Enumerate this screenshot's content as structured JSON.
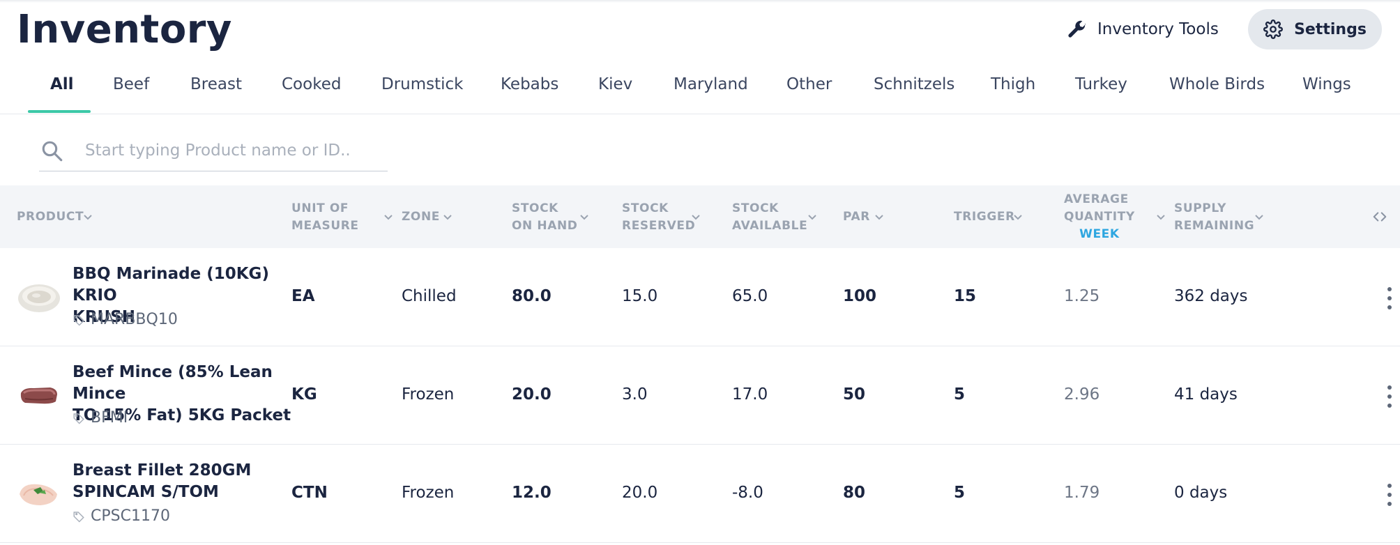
{
  "header": {
    "title": "Inventory",
    "tools_label": "Inventory Tools",
    "settings_label": "Settings"
  },
  "tabs": [
    {
      "label": "All",
      "active": true
    },
    {
      "label": "Beef"
    },
    {
      "label": "Breast"
    },
    {
      "label": "Cooked"
    },
    {
      "label": "Drumstick"
    },
    {
      "label": "Kebabs"
    },
    {
      "label": "Kiev"
    },
    {
      "label": "Maryland"
    },
    {
      "label": "Other"
    },
    {
      "label": "Schnitzels"
    },
    {
      "label": "Thigh"
    },
    {
      "label": "Turkey"
    },
    {
      "label": "Whole Birds"
    },
    {
      "label": "Wings"
    }
  ],
  "search": {
    "placeholder": "Start typing Product name or ID..",
    "value": ""
  },
  "table": {
    "columns": {
      "product": "PRODUCT",
      "uom_1": "UNIT OF",
      "uom_2": "MEASURE",
      "zone": "ZONE",
      "on_hand_1": "STOCK",
      "on_hand_2": "ON HAND",
      "reserved_1": "STOCK",
      "reserved_2": "RESERVED",
      "available_1": "STOCK",
      "available_2": "AVAILABLE",
      "par": "PAR",
      "trigger": "TRIGGER",
      "avg_1": "AVERAGE",
      "avg_2": "QUANTITY",
      "avg_period": "WEEK",
      "supply_1": "SUPPLY",
      "supply_2": "REMAINING"
    },
    "rows": [
      {
        "name_line1": "BBQ Marinade (10KG) KRIO",
        "name_line2": "KRUSH",
        "id": "MARBBQ10",
        "thumb": "marinade-bowl-thumb",
        "uom": "EA",
        "zone": "Chilled",
        "on_hand": "80.0",
        "reserved": "15.0",
        "available": "65.0",
        "par": "100",
        "trigger": "15",
        "avg_qty": "1.25",
        "supply": "362 days"
      },
      {
        "name_line1": "Beef Mince (85% Lean Mince",
        "name_line2": "TO 15% Fat) 5KG Packet",
        "id": "BFMI",
        "thumb": "beef-mince-thumb",
        "uom": "KG",
        "zone": "Frozen",
        "on_hand": "20.0",
        "reserved": "3.0",
        "available": "17.0",
        "par": "50",
        "trigger": "5",
        "avg_qty": "2.96",
        "supply": "41 days"
      },
      {
        "name_line1": "Breast Fillet 280GM",
        "name_line2": "SPINCAM S/TOM",
        "id": "CPSC1170",
        "thumb": "breast-fillet-thumb",
        "uom": "CTN",
        "zone": "Frozen",
        "on_hand": "12.0",
        "reserved": "20.0",
        "available": "-8.0",
        "par": "80",
        "trigger": "5",
        "avg_qty": "1.79",
        "supply": "0 days"
      }
    ]
  },
  "colors": {
    "title": "#1b2540",
    "accent_underline": "#3cc8a7",
    "period_link": "#2ea6e0",
    "header_bg": "#f3f5f8",
    "settings_bg": "#e4e8ed"
  }
}
